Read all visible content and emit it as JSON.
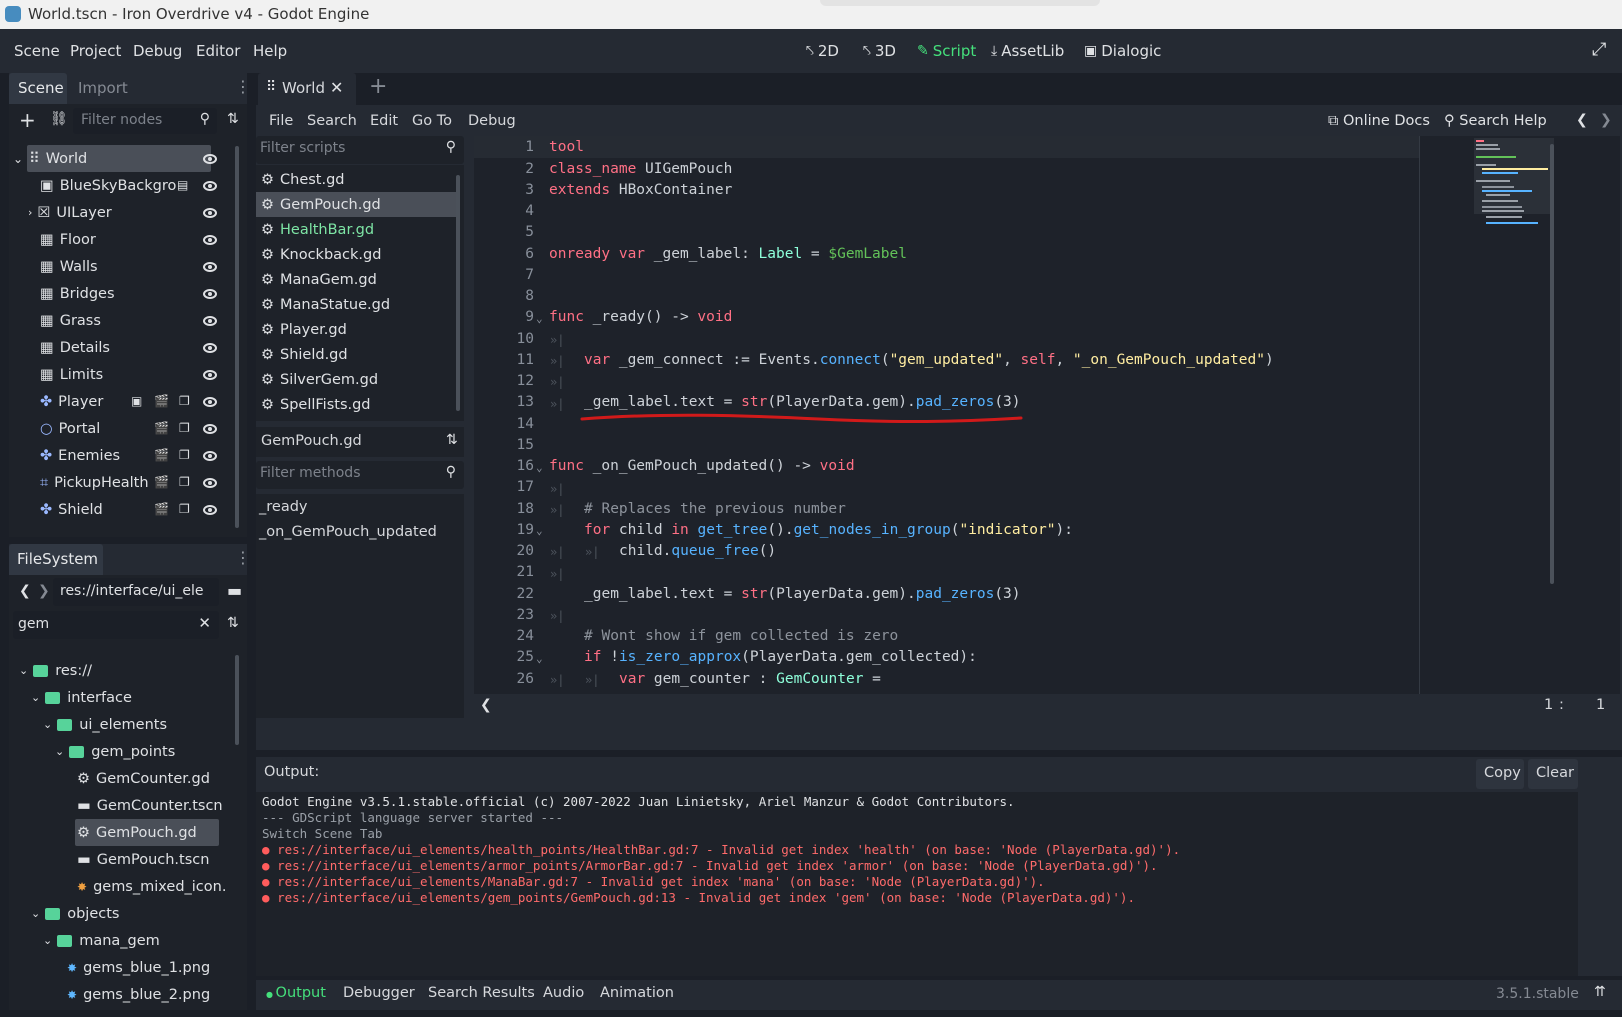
{
  "window": {
    "title": "World.tscn - Iron Overdrive v4 - Godot Engine"
  },
  "menu": [
    "Scene",
    "Project",
    "Debug",
    "Editor",
    "Help"
  ],
  "workspaces": [
    {
      "label": "2D",
      "icon": "2d-icon"
    },
    {
      "label": "3D",
      "icon": "3d-icon"
    },
    {
      "label": "Script",
      "icon": "script-icon",
      "active": true
    },
    {
      "label": "AssetLib",
      "icon": "assetlib-icon"
    },
    {
      "label": "Dialogic",
      "icon": "dialogic-icon"
    }
  ],
  "scene_dock": {
    "tabs": [
      "Scene",
      "Import"
    ],
    "filter_placeholder": "Filter nodes",
    "nodes": [
      {
        "label": "World",
        "selected": true
      },
      {
        "label": "BlueSkyBackgro"
      },
      {
        "label": "UILayer"
      },
      {
        "label": "Floor"
      },
      {
        "label": "Walls"
      },
      {
        "label": "Bridges"
      },
      {
        "label": "Grass"
      },
      {
        "label": "Details"
      },
      {
        "label": "Limits"
      },
      {
        "label": "Player"
      },
      {
        "label": "Portal"
      },
      {
        "label": "Enemies"
      },
      {
        "label": "PickupHealth"
      },
      {
        "label": "Shield"
      }
    ]
  },
  "filesystem": {
    "title": "FileSystem",
    "path": "res://interface/ui_ele",
    "search": "gem",
    "items": [
      {
        "label": "res://",
        "type": "folder"
      },
      {
        "label": "interface",
        "type": "folder"
      },
      {
        "label": "ui_elements",
        "type": "folder"
      },
      {
        "label": "gem_points",
        "type": "folder"
      },
      {
        "label": "GemCounter.gd",
        "type": "script"
      },
      {
        "label": "GemCounter.tscn",
        "type": "scene"
      },
      {
        "label": "GemPouch.gd",
        "type": "script",
        "selected": true
      },
      {
        "label": "GemPouch.tscn",
        "type": "scene"
      },
      {
        "label": "gems_mixed_icon.",
        "type": "image"
      },
      {
        "label": "objects",
        "type": "folder"
      },
      {
        "label": "mana_gem",
        "type": "folder"
      },
      {
        "label": "gems_blue_1.png",
        "type": "image"
      },
      {
        "label": "gems_blue_2.png",
        "type": "image"
      }
    ]
  },
  "editor_tab": {
    "label": "World"
  },
  "script_menu": [
    "File",
    "Search",
    "Edit",
    "Go To",
    "Debug"
  ],
  "script_help": {
    "docs": "Online Docs",
    "search_help": "Search Help"
  },
  "scripts": {
    "filter_placeholder": "Filter scripts",
    "items": [
      "Chest.gd",
      "GemPouch.gd",
      "HealthBar.gd",
      "Knockback.gd",
      "ManaGem.gd",
      "ManaStatue.gd",
      "Player.gd",
      "Shield.gd",
      "SilverGem.gd",
      "SpellFists.gd"
    ],
    "current": "GemPouch.gd",
    "methods_placeholder": "Filter methods",
    "methods": [
      "_ready",
      "_on_GemPouch_updated"
    ]
  },
  "code": {
    "line_numbers": [
      "1",
      "2",
      "3",
      "4",
      "5",
      "6",
      "7",
      "8",
      "9",
      "10",
      "11",
      "12",
      "13",
      "14",
      "15",
      "16",
      "17",
      "18",
      "19",
      "20",
      "21",
      "22",
      "23",
      "24",
      "25",
      "26"
    ],
    "lines": {
      "l1": "tool",
      "l2a": "class_name ",
      "l2b": "UIGemPouch",
      "l3a": "extends ",
      "l3b": "HBoxContainer",
      "l6a": "onready var ",
      "l6b": "_gem_label: ",
      "l6c": "Label",
      "l6d": " = ",
      "l6e": "$GemLabel",
      "l9a": "func ",
      "l9b": "_ready() -> ",
      "l9c": "void",
      "l11a": "var ",
      "l11b": "_gem_connect := Events.",
      "l11c": "connect",
      "l11d": "(",
      "l11e": "\"gem_updated\"",
      "l11f": ", ",
      "l11g": "self",
      "l11h": ", ",
      "l11i": "\"_on_GemPouch_updated\"",
      "l11j": ")",
      "l13a": "_gem_label.text = ",
      "l13b": "str",
      "l13c": "(PlayerData.gem).",
      "l13d": "pad_zeros",
      "l13e": "(3)",
      "l16a": "func ",
      "l16b": "_on_GemPouch_updated() -> ",
      "l16c": "void",
      "l18": "# Replaces the previous number",
      "l19a": "for ",
      "l19b": "child ",
      "l19c": "in ",
      "l19d": "get_tree",
      "l19e": "().",
      "l19f": "get_nodes_in_group",
      "l19g": "(",
      "l19h": "\"indicator\"",
      "l19i": "):",
      "l20a": "child.",
      "l20b": "queue_free",
      "l20c": "()",
      "l22a": "_gem_label.text = ",
      "l22b": "str",
      "l22c": "(PlayerData.gem).",
      "l22d": "pad_zeros",
      "l22e": "(3)",
      "l24": "# Wont show if gem collected is zero",
      "l25a": "if ",
      "l25b": "!",
      "l25c": "is_zero_approx",
      "l25d": "(PlayerData.gem_collected):",
      "l26a": "var ",
      "l26b": "gem_counter : ",
      "l26c": "GemCounter",
      "l26d": " ="
    },
    "cursor_line": "1",
    "cursor_col": "1"
  },
  "output": {
    "label": "Output:",
    "copy": "Copy",
    "clear": "Clear",
    "lines": [
      "Godot Engine v3.5.1.stable.official (c) 2007-2022 Juan Linietsky, Ariel Manzur & Godot Contributors.",
      "--- GDScript language server started ---",
      "Switch Scene Tab"
    ],
    "errors": [
      "res://interface/ui_elements/health_points/HealthBar.gd:7 - Invalid get index 'health' (on base: 'Node (PlayerData.gd)').",
      "res://interface/ui_elements/armor_points/ArmorBar.gd:7 - Invalid get index 'armor' (on base: 'Node (PlayerData.gd)').",
      "res://interface/ui_elements/ManaBar.gd:7 - Invalid get index 'mana' (on base: 'Node (PlayerData.gd)').",
      "res://interface/ui_elements/gem_points/GemPouch.gd:13 - Invalid get index 'gem' (on base: 'Node (PlayerData.gd)')."
    ]
  },
  "bottom_tabs": [
    "Output",
    "Debugger",
    "Search Results",
    "Audio",
    "Animation"
  ],
  "version": "3.5.1.stable",
  "colors": {
    "accent": "#45e07c",
    "error": "#ff6b6b",
    "annotation": "#d11a1a"
  }
}
